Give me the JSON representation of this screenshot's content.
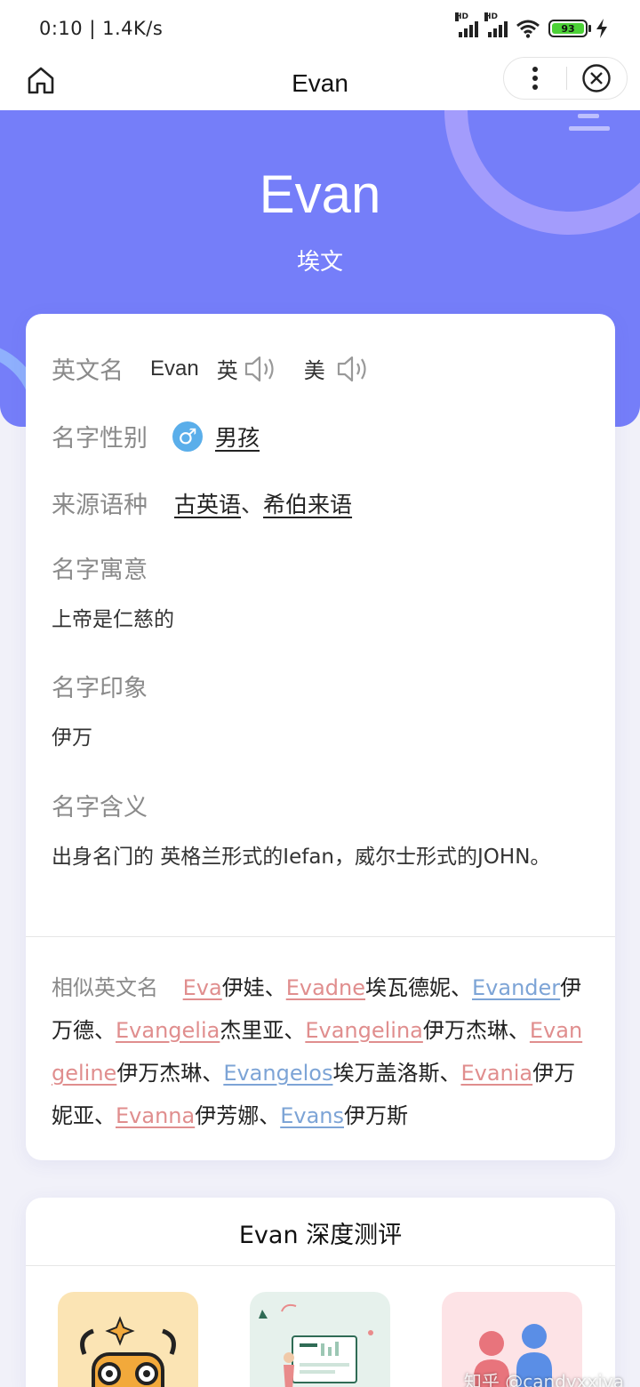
{
  "status_bar": {
    "time": "0:10 | 1.4K/s",
    "signal1_label": "HD",
    "signal2_label": "HD",
    "battery_level": "93"
  },
  "nav": {
    "title": "Evan",
    "home_icon": "home-icon",
    "more_icon": "more-vertical-icon",
    "close_icon": "close-circle-icon"
  },
  "hero": {
    "name": "Evan",
    "chinese_name": "埃文",
    "background_color": "#757ef9"
  },
  "info": {
    "english_name_label": "英文名",
    "english_name_value": "Evan",
    "uk_label": "英",
    "us_label": "美",
    "gender_label": "名字性别",
    "gender_symbol": "♂",
    "gender_value": "男孩",
    "origin_label": "来源语种",
    "origin_values": [
      "古英语",
      "希伯来语"
    ],
    "origin_separator": "、",
    "meaning_label": "名字寓意",
    "meaning_value": "上帝是仁慈的",
    "impression_label": "名字印象",
    "impression_value": "伊万",
    "definition_label": "名字含义",
    "definition_value": "出身名门的 英格兰形式的Iefan，威尔士形式的JOHN。"
  },
  "similar": {
    "label": "相似英文名",
    "items": [
      {
        "en": "Eva",
        "zh": "伊娃",
        "color": "red"
      },
      {
        "en": "Evadne",
        "zh": "埃瓦德妮",
        "color": "red"
      },
      {
        "en": "Evander",
        "zh": "伊万德",
        "color": "blue"
      },
      {
        "en": "Evangelia",
        "zh": "杰里亚",
        "color": "red"
      },
      {
        "en": "Evangelina",
        "zh": "伊万杰琳",
        "color": "red"
      },
      {
        "en": "Evangeline",
        "zh": "伊万杰琳",
        "color": "red"
      },
      {
        "en": "Evangelos",
        "zh": "埃万盖洛斯",
        "color": "blue"
      },
      {
        "en": "Evania",
        "zh": "伊万妮亚",
        "color": "red"
      },
      {
        "en": "Evanna",
        "zh": "伊芳娜",
        "color": "red"
      },
      {
        "en": "Evans",
        "zh": "伊万斯",
        "color": "blue"
      }
    ],
    "separator": "、"
  },
  "evaluation": {
    "title": "Evan 深度测评"
  },
  "watermark": "知乎 @candyxxiya"
}
